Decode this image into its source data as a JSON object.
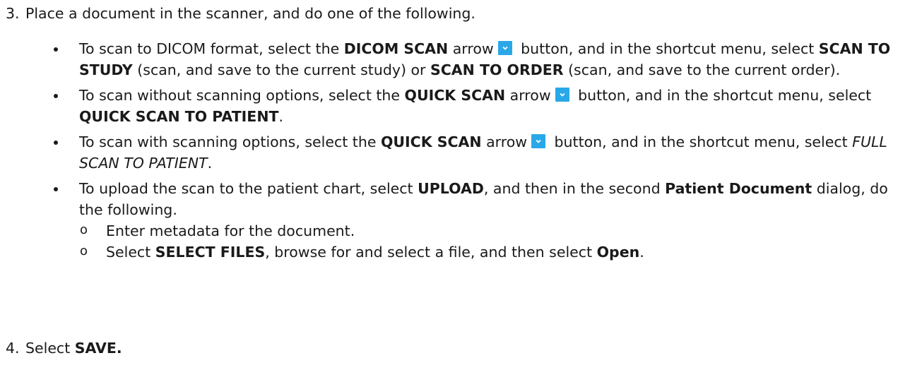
{
  "step3": {
    "number": "3.",
    "text": "Place a document in the scanner, and do one of the following."
  },
  "bullets": [
    {
      "t1": "To scan to DICOM format, select the ",
      "b1": "DICOM SCAN",
      "t2": " arrow",
      "t3": " button, and in the shortcut menu, select ",
      "b2": "SCAN TO STUDY",
      "t4": " (scan, and save to the current study) or ",
      "b3": "SCAN TO ORDER",
      "t5": " (scan, and save to the current order)."
    },
    {
      "t1": "To scan without scanning options, select the ",
      "b1": "QUICK SCAN",
      "t2": " arrow",
      "t3": " button, and in the shortcut menu, select ",
      "b2": "QUICK SCAN TO PATIENT",
      "t4": "."
    },
    {
      "t1": "To scan with scanning options, select the ",
      "b1": "QUICK SCAN",
      "t2": " arrow",
      "t3": " button, and in the shortcut menu, select ",
      "i1": "FULL SCAN TO PATIENT",
      "t4": "."
    },
    {
      "t1": "To upload the scan to the patient chart, select ",
      "b1": "UPLOAD",
      "t2": ", and then in the second ",
      "b2": "Patient Document",
      "t3": " dialog, do the following.",
      "sub": [
        {
          "t1": "Enter metadata for the document."
        },
        {
          "t1": "Select ",
          "b1": "SELECT FILES",
          "t2": ", browse for and select a file, and then select ",
          "b2": "Open",
          "t3": "."
        }
      ]
    }
  ],
  "step4": {
    "number": "4.",
    "t1": "Select ",
    "b1": "SAVE."
  },
  "icons": {
    "arrow_button": "dropdown-arrow-icon",
    "arrow_button_color": "#29a8e8"
  }
}
